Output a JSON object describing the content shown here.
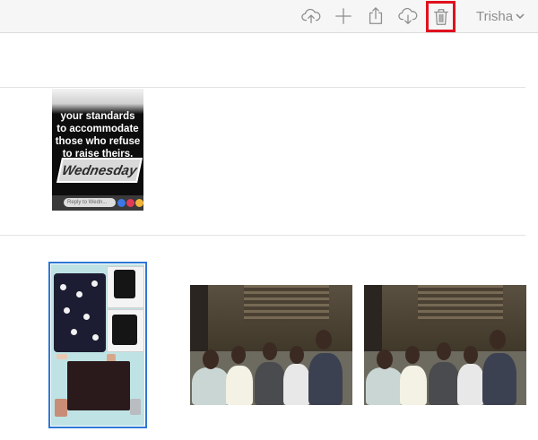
{
  "toolbar": {
    "icons": [
      "upload-cloud-icon",
      "plus-icon",
      "share-icon",
      "download-cloud-icon",
      "trash-icon"
    ],
    "user_name": "Trisha"
  },
  "photos": {
    "meme": {
      "quote_lines": [
        "your standards",
        "to accommodate",
        "those who refuse",
        "to raise theirs."
      ],
      "brand": "Wednesday",
      "reply_placeholder": "Reply to Wedn..."
    }
  },
  "colors": {
    "toolbar_bg": "#f6f6f6",
    "icon_gray": "#8e8e8e",
    "highlight_red": "#e0111e",
    "selection_blue": "#2e78d6"
  }
}
